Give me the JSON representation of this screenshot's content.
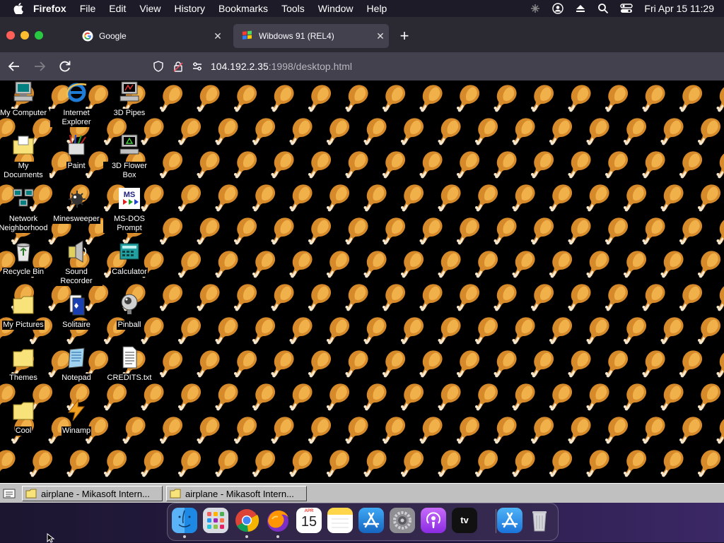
{
  "menubar": {
    "app_name": "Firefox",
    "items": [
      "File",
      "Edit",
      "View",
      "History",
      "Bookmarks",
      "Tools",
      "Window",
      "Help"
    ],
    "clock": "Fri Apr 15  11:29"
  },
  "browser": {
    "tabs": [
      {
        "title": "Google",
        "icon": "google-icon"
      },
      {
        "title": "Wibdows 91 (REL4)",
        "icon": "windows-icon",
        "active": true
      }
    ],
    "url": {
      "host": "104.192.2.35",
      "path": ":1998/desktop.html"
    }
  },
  "desktop": {
    "wallpaper": "drumstick-pattern",
    "icons": [
      {
        "label": "My Computer",
        "icon": "computer-icon"
      },
      {
        "label": "Internet Explorer",
        "icon": "internet-explorer-icon"
      },
      {
        "label": "3D Pipes",
        "icon": "screensaver-icon"
      },
      {
        "label": "My Documents",
        "icon": "documents-folder-icon"
      },
      {
        "label": "Paint",
        "icon": "paint-icon"
      },
      {
        "label": "3D Flower Box",
        "icon": "screensaver-icon"
      },
      {
        "label": "Network Neighborhood",
        "icon": "network-icon"
      },
      {
        "label": "Minesweeper",
        "icon": "minesweeper-icon"
      },
      {
        "label": "MS-DOS Prompt",
        "icon": "msdos-icon"
      },
      {
        "label": "Recycle Bin",
        "icon": "recycle-bin-icon"
      },
      {
        "label": "Sound Recorder",
        "icon": "sound-recorder-icon"
      },
      {
        "label": "Calculator",
        "icon": "calculator-icon"
      },
      {
        "label": "My Pictures",
        "icon": "folder-icon"
      },
      {
        "label": "Solitaire",
        "icon": "solitaire-icon"
      },
      {
        "label": "Pinball",
        "icon": "pinball-icon"
      },
      {
        "label": "Themes",
        "icon": "folder-icon"
      },
      {
        "label": "Notepad",
        "icon": "notepad-icon"
      },
      {
        "label": "CREDITS.txt",
        "icon": "text-file-icon"
      },
      {
        "label": "Cool",
        "icon": "folder-icon"
      },
      {
        "label": "Winamp",
        "icon": "winamp-icon"
      }
    ]
  },
  "taskbar": {
    "windows": [
      {
        "label": "airplane - Mikasoft Intern...",
        "icon": "folder-icon"
      },
      {
        "label": "airplane - Mikasoft Intern...",
        "icon": "folder-icon"
      }
    ]
  },
  "dock": {
    "apps": [
      "Finder",
      "Launchpad",
      "Google Chrome",
      "Firefox",
      "Calendar",
      "Notes",
      "App Store",
      "System Preferences",
      "Podcasts",
      "Apple TV",
      "Applications",
      "Trash"
    ],
    "calendar": {
      "month": "APR",
      "day": "15"
    },
    "tv_label": "tv"
  }
}
